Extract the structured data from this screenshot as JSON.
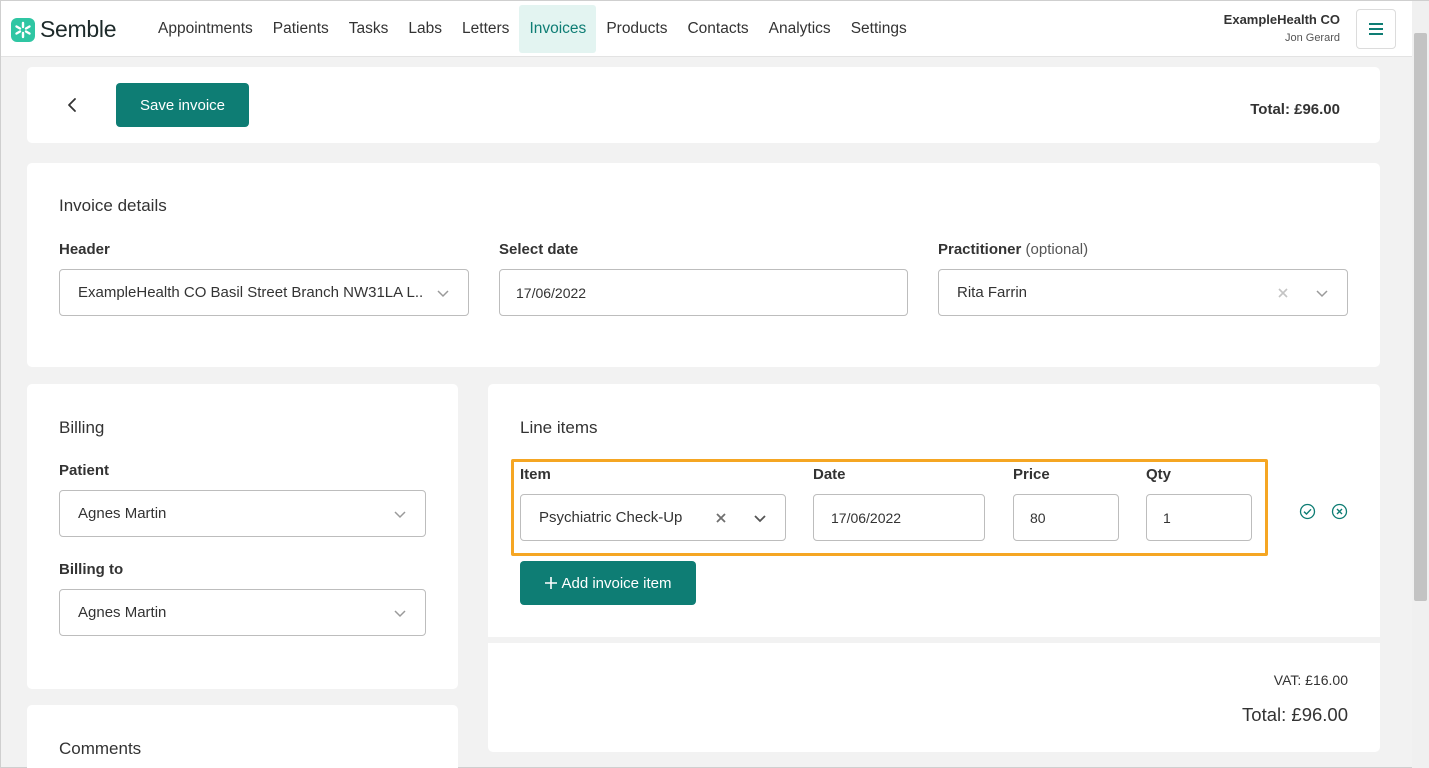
{
  "app": {
    "brand": "Semble",
    "nav": [
      {
        "label": "Appointments",
        "active": false
      },
      {
        "label": "Patients",
        "active": false
      },
      {
        "label": "Tasks",
        "active": false
      },
      {
        "label": "Labs",
        "active": false
      },
      {
        "label": "Letters",
        "active": false
      },
      {
        "label": "Invoices",
        "active": true
      },
      {
        "label": "Products",
        "active": false
      },
      {
        "label": "Contacts",
        "active": false
      },
      {
        "label": "Analytics",
        "active": false
      },
      {
        "label": "Settings",
        "active": false
      }
    ],
    "org_name": "ExampleHealth CO",
    "user_name": "Jon Gerard"
  },
  "toolbar": {
    "save_label": "Save invoice",
    "total": "Total: £96.00"
  },
  "invoice_details": {
    "title": "Invoice details",
    "header_label": "Header",
    "header_value": "ExampleHealth CO Basil Street Branch NW31LA L...",
    "date_label": "Select date",
    "date_value": "17/06/2022",
    "practitioner_label": "Practitioner",
    "practitioner_optional": "(optional)",
    "practitioner_value": "Rita Farrin"
  },
  "billing": {
    "title": "Billing",
    "patient_label": "Patient",
    "patient_value": "Agnes Martin",
    "billing_to_label": "Billing to",
    "billing_to_value": "Agnes Martin"
  },
  "comments": {
    "title": "Comments"
  },
  "line_items": {
    "title": "Line items",
    "col_item": "Item",
    "col_date": "Date",
    "col_price": "Price",
    "col_qty": "Qty",
    "rows": [
      {
        "item": "Psychiatric Check-Up",
        "date": "17/06/2022",
        "price": "80",
        "qty": "1"
      }
    ],
    "add_label": "Add invoice item"
  },
  "summary": {
    "vat": "VAT: £16.00",
    "total": "Total: £96.00"
  },
  "colors": {
    "primary": "#0e7d74",
    "brand": "#2fc6a3",
    "highlight": "#f5a623"
  },
  "icons": [
    "back-icon",
    "hamburger-icon",
    "chevron-down-icon",
    "clear-icon",
    "confirm-icon",
    "cancel-icon",
    "plus-icon"
  ]
}
